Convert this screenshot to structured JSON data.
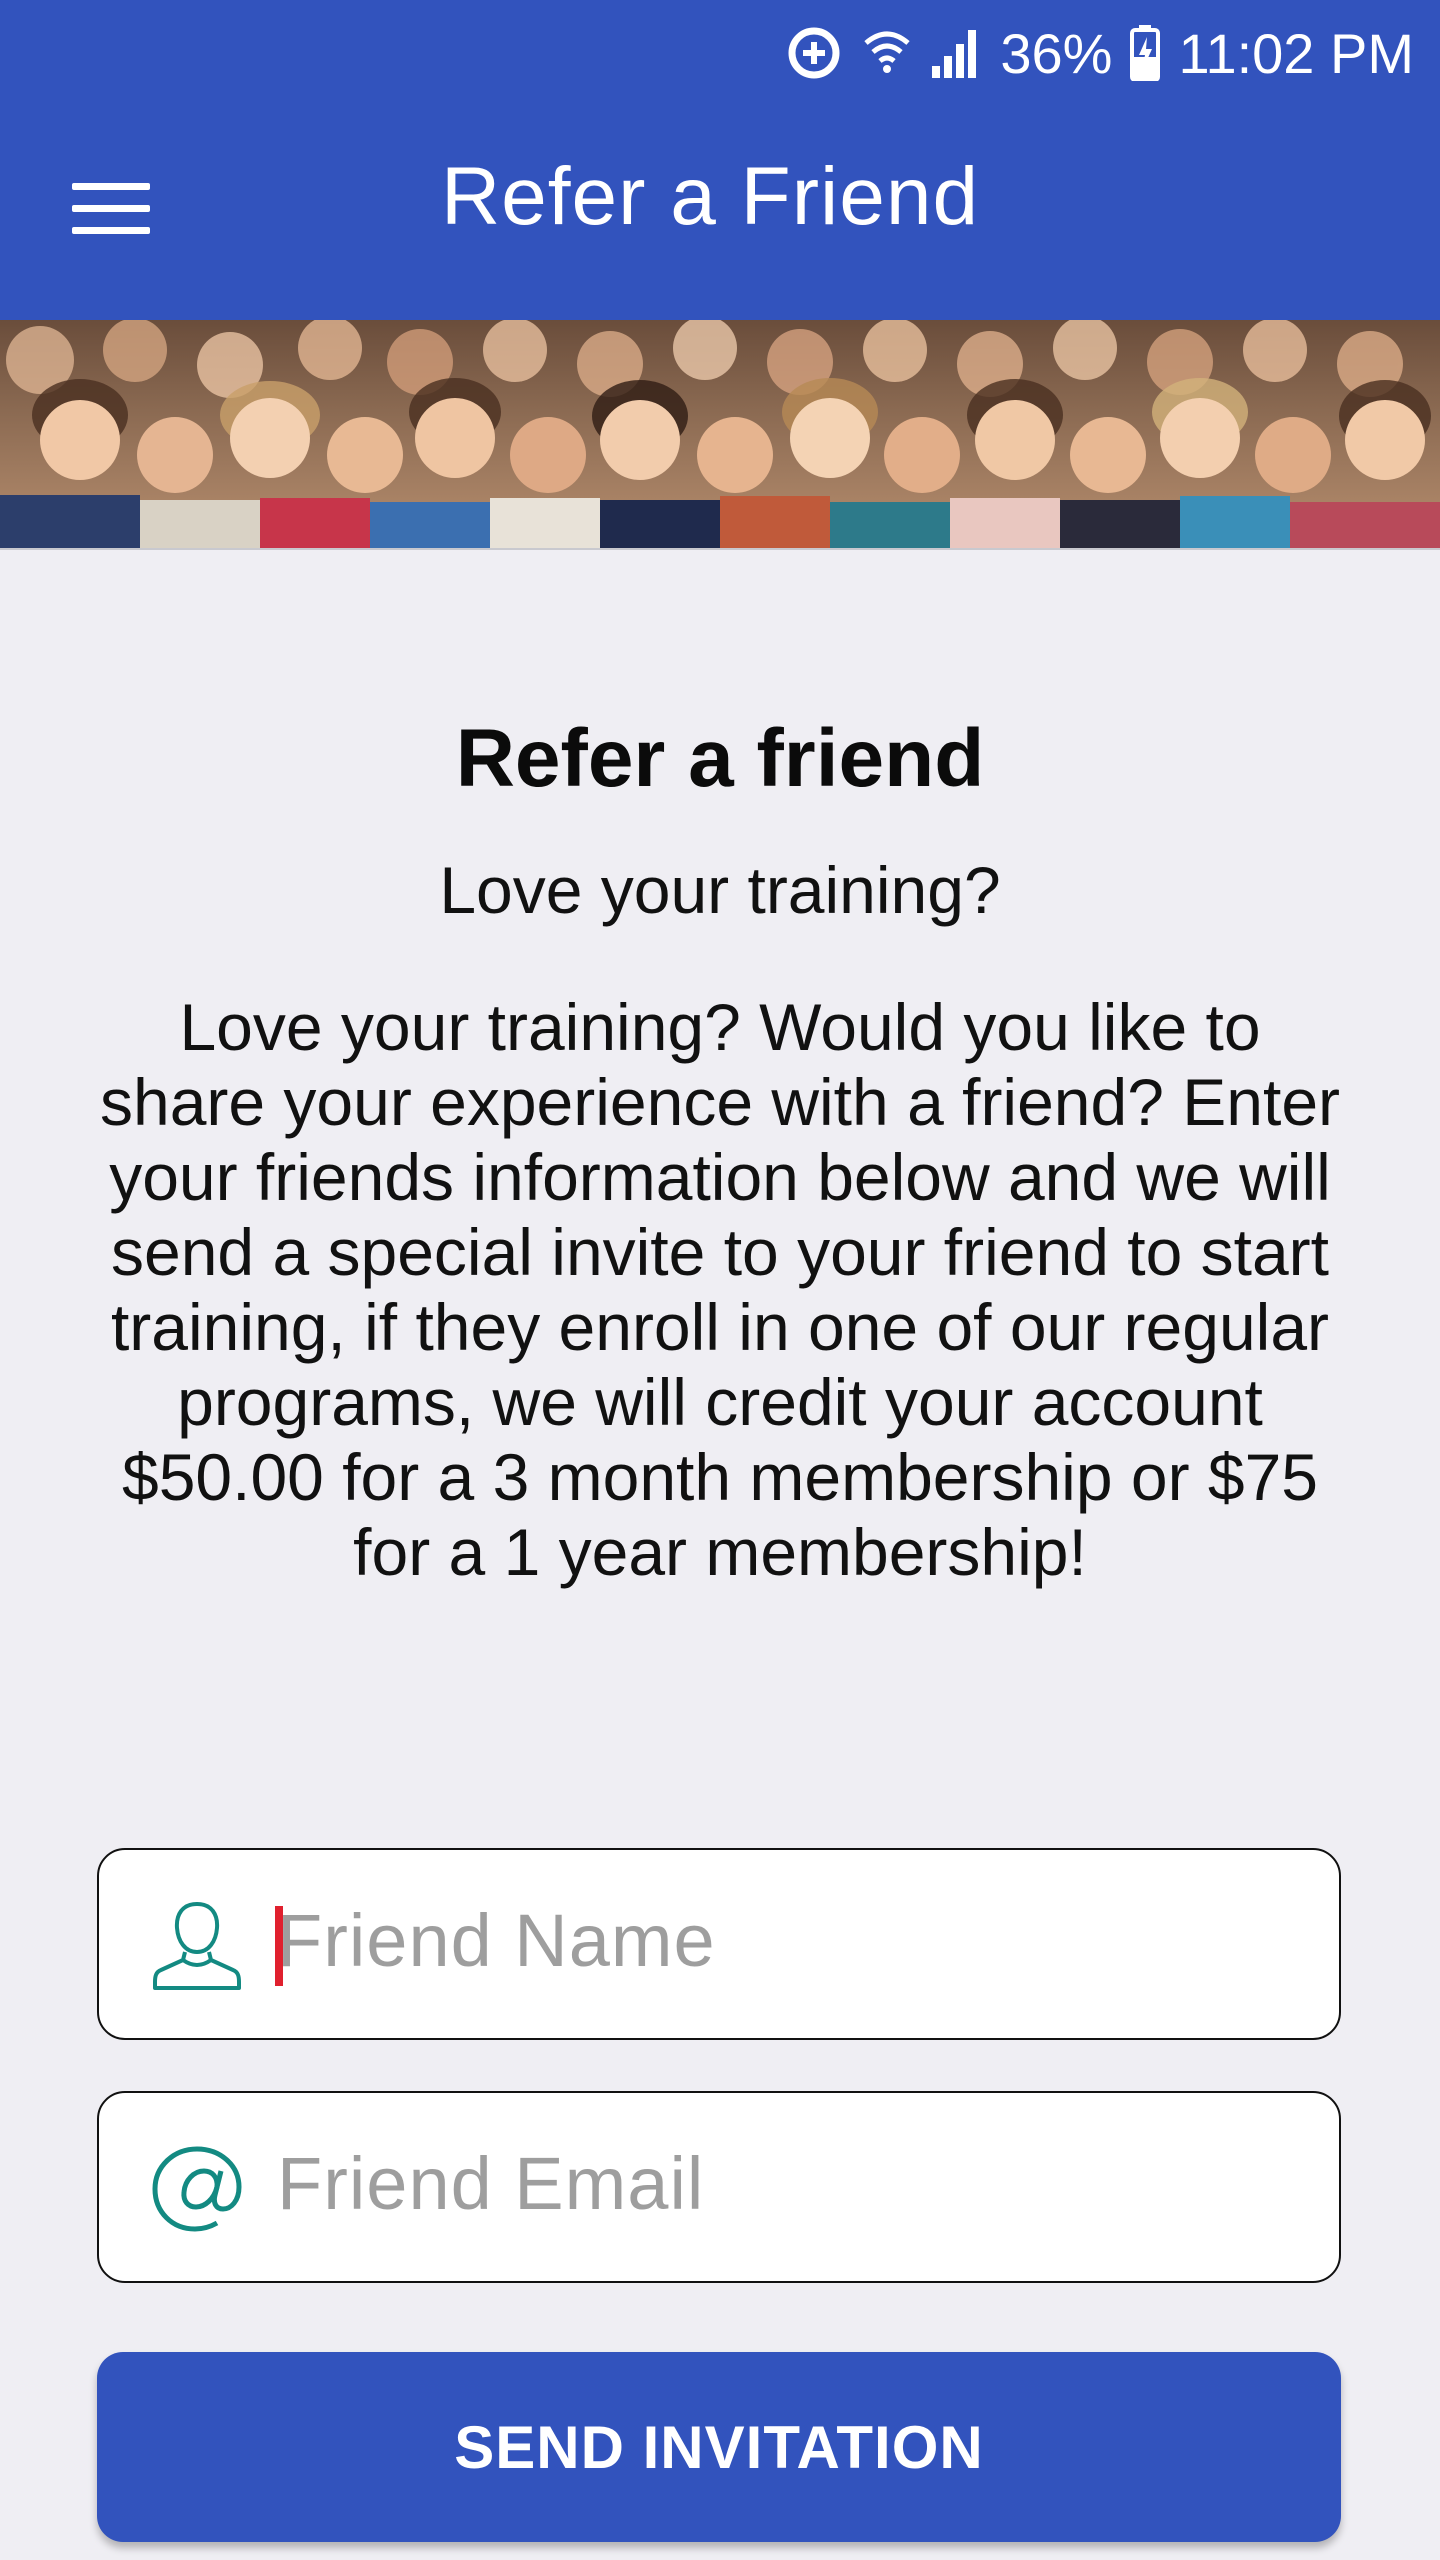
{
  "status_bar": {
    "battery": "36%",
    "time": "11:02 PM"
  },
  "app_bar": {
    "title": "Refer a Friend"
  },
  "content": {
    "heading": "Refer a friend",
    "subheading": "Love your training?",
    "body": "Love your training? Would you like to share your experience with a friend? Enter your friends information below and we will send a special invite to your friend to start training, if they enroll in one of our regular programs, we will credit your account $50.00 for a 3 month membership or $75 for a 1 year membership!"
  },
  "form": {
    "name_placeholder": "Friend Name",
    "email_placeholder": "Friend Email",
    "submit_label": "SEND INVITATION"
  },
  "colors": {
    "primary": "#3253bd",
    "icon_teal": "#138a82",
    "caret": "#e0202e",
    "background": "#efeef3"
  }
}
